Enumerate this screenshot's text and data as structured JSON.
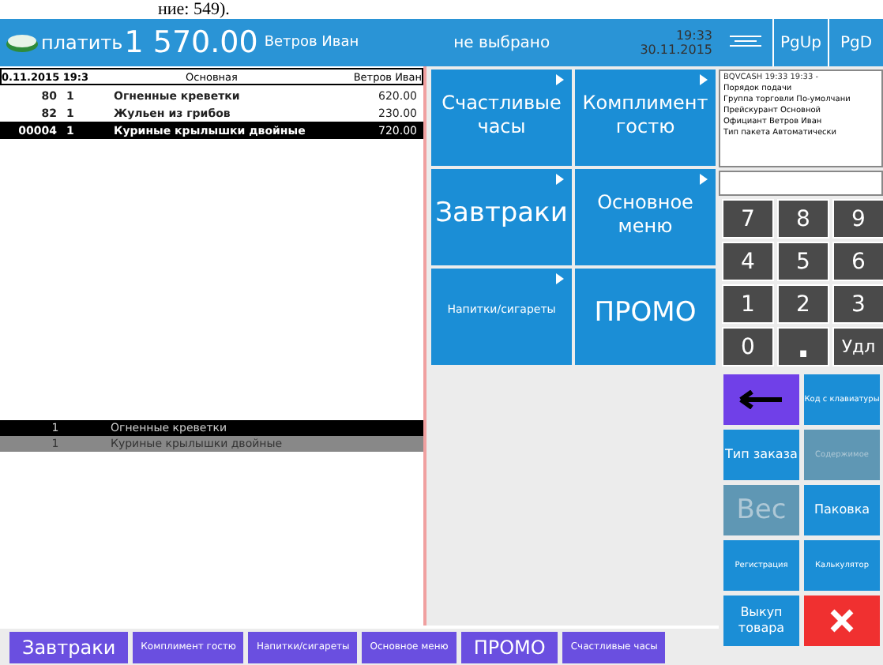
{
  "caption_fragment": "ние: 549).",
  "header": {
    "label": "платить",
    "total": "1 570.00",
    "waiter": "Ветров Иван",
    "table": "не выбрано",
    "time": "19:33",
    "date": "30.11.2015",
    "buttons": [
      {
        "kind": "lines"
      },
      {
        "kind": "text",
        "label": "PgUp"
      },
      {
        "kind": "text",
        "label": "PgD"
      }
    ]
  },
  "order": {
    "header": [
      "0.11.2015 19:3",
      "Основная",
      "Ветров Иван"
    ],
    "rows": [
      {
        "code": "80",
        "qty": "1",
        "name": "Огненные креветки",
        "price": "620.00",
        "selected": false
      },
      {
        "code": "82",
        "qty": "1",
        "name": "Жульен из грибов",
        "price": "230.00",
        "selected": false
      },
      {
        "code": "00004",
        "qty": "1",
        "name": "Куриные крылышки двойные",
        "price": "720.00",
        "selected": true
      }
    ]
  },
  "details": [
    {
      "qty": "1",
      "name": "Огненные креветки",
      "selected": true
    },
    {
      "qty": "1",
      "name": "Куриные крылышки двойные",
      "selected": false
    }
  ],
  "tiles": [
    {
      "label": "Счастливые часы",
      "kind": "medium",
      "arrow": true
    },
    {
      "label": "Комплимент гостю",
      "kind": "medium",
      "arrow": true
    },
    {
      "label": "Завтраки",
      "kind": "large",
      "arrow": true
    },
    {
      "label": "Основное меню",
      "kind": "medium",
      "arrow": true
    },
    {
      "label": "Напитки/сигареты",
      "kind": "small",
      "arrow": true
    },
    {
      "label": "ПРОМО",
      "kind": "large",
      "arrow": false
    }
  ],
  "info": {
    "title": "BQVCASH   19:33   19:33   -",
    "lines": [
      "Порядок подачи",
      "Группа торговли По-умолчани",
      "Прейскурант Основной",
      "Официант Ветров Иван",
      "Тип пакета Автоматически"
    ]
  },
  "keypad": [
    "7",
    "8",
    "9",
    "4",
    "5",
    "6",
    "1",
    "2",
    "3",
    "0",
    ".",
    "Удл"
  ],
  "actions": [
    {
      "kind": "back"
    },
    {
      "kind": "small",
      "label": "Код с клавиатуры",
      "disabled": false
    },
    {
      "kind": "medium",
      "label": "Тип заказа",
      "disabled": false
    },
    {
      "kind": "small",
      "label": "Содержимое",
      "disabled": true
    },
    {
      "kind": "large",
      "label": "Вес",
      "disabled": true
    },
    {
      "kind": "medium",
      "label": "Паковка",
      "disabled": false
    },
    {
      "kind": "small",
      "label": "Регистрация",
      "disabled": false
    },
    {
      "kind": "small",
      "label": "Калькулятор",
      "disabled": false
    },
    {
      "kind": "medium",
      "label": "Выкуп товара",
      "disabled": false
    },
    {
      "kind": "close"
    }
  ],
  "categories": [
    {
      "label": "Завтраки",
      "kind": "large"
    },
    {
      "label": "Комплимент гостю",
      "kind": "small"
    },
    {
      "label": "Напитки/сигареты",
      "kind": "small"
    },
    {
      "label": "Основное меню",
      "kind": "small"
    },
    {
      "label": "ПРОМО",
      "kind": "large"
    },
    {
      "label": "Счастливые часы",
      "kind": "small"
    }
  ]
}
